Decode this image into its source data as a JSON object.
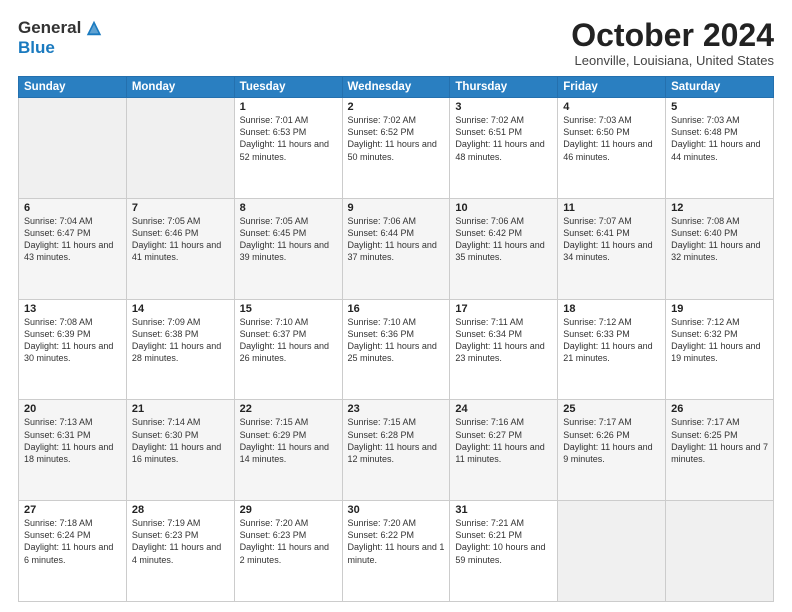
{
  "header": {
    "logo_general": "General",
    "logo_blue": "Blue",
    "month_title": "October 2024",
    "location": "Leonville, Louisiana, United States"
  },
  "weekdays": [
    "Sunday",
    "Monday",
    "Tuesday",
    "Wednesday",
    "Thursday",
    "Friday",
    "Saturday"
  ],
  "weeks": [
    [
      {
        "day": "",
        "info": ""
      },
      {
        "day": "",
        "info": ""
      },
      {
        "day": "1",
        "info": "Sunrise: 7:01 AM\nSunset: 6:53 PM\nDaylight: 11 hours and 52 minutes."
      },
      {
        "day": "2",
        "info": "Sunrise: 7:02 AM\nSunset: 6:52 PM\nDaylight: 11 hours and 50 minutes."
      },
      {
        "day": "3",
        "info": "Sunrise: 7:02 AM\nSunset: 6:51 PM\nDaylight: 11 hours and 48 minutes."
      },
      {
        "day": "4",
        "info": "Sunrise: 7:03 AM\nSunset: 6:50 PM\nDaylight: 11 hours and 46 minutes."
      },
      {
        "day": "5",
        "info": "Sunrise: 7:03 AM\nSunset: 6:48 PM\nDaylight: 11 hours and 44 minutes."
      }
    ],
    [
      {
        "day": "6",
        "info": "Sunrise: 7:04 AM\nSunset: 6:47 PM\nDaylight: 11 hours and 43 minutes."
      },
      {
        "day": "7",
        "info": "Sunrise: 7:05 AM\nSunset: 6:46 PM\nDaylight: 11 hours and 41 minutes."
      },
      {
        "day": "8",
        "info": "Sunrise: 7:05 AM\nSunset: 6:45 PM\nDaylight: 11 hours and 39 minutes."
      },
      {
        "day": "9",
        "info": "Sunrise: 7:06 AM\nSunset: 6:44 PM\nDaylight: 11 hours and 37 minutes."
      },
      {
        "day": "10",
        "info": "Sunrise: 7:06 AM\nSunset: 6:42 PM\nDaylight: 11 hours and 35 minutes."
      },
      {
        "day": "11",
        "info": "Sunrise: 7:07 AM\nSunset: 6:41 PM\nDaylight: 11 hours and 34 minutes."
      },
      {
        "day": "12",
        "info": "Sunrise: 7:08 AM\nSunset: 6:40 PM\nDaylight: 11 hours and 32 minutes."
      }
    ],
    [
      {
        "day": "13",
        "info": "Sunrise: 7:08 AM\nSunset: 6:39 PM\nDaylight: 11 hours and 30 minutes."
      },
      {
        "day": "14",
        "info": "Sunrise: 7:09 AM\nSunset: 6:38 PM\nDaylight: 11 hours and 28 minutes."
      },
      {
        "day": "15",
        "info": "Sunrise: 7:10 AM\nSunset: 6:37 PM\nDaylight: 11 hours and 26 minutes."
      },
      {
        "day": "16",
        "info": "Sunrise: 7:10 AM\nSunset: 6:36 PM\nDaylight: 11 hours and 25 minutes."
      },
      {
        "day": "17",
        "info": "Sunrise: 7:11 AM\nSunset: 6:34 PM\nDaylight: 11 hours and 23 minutes."
      },
      {
        "day": "18",
        "info": "Sunrise: 7:12 AM\nSunset: 6:33 PM\nDaylight: 11 hours and 21 minutes."
      },
      {
        "day": "19",
        "info": "Sunrise: 7:12 AM\nSunset: 6:32 PM\nDaylight: 11 hours and 19 minutes."
      }
    ],
    [
      {
        "day": "20",
        "info": "Sunrise: 7:13 AM\nSunset: 6:31 PM\nDaylight: 11 hours and 18 minutes."
      },
      {
        "day": "21",
        "info": "Sunrise: 7:14 AM\nSunset: 6:30 PM\nDaylight: 11 hours and 16 minutes."
      },
      {
        "day": "22",
        "info": "Sunrise: 7:15 AM\nSunset: 6:29 PM\nDaylight: 11 hours and 14 minutes."
      },
      {
        "day": "23",
        "info": "Sunrise: 7:15 AM\nSunset: 6:28 PM\nDaylight: 11 hours and 12 minutes."
      },
      {
        "day": "24",
        "info": "Sunrise: 7:16 AM\nSunset: 6:27 PM\nDaylight: 11 hours and 11 minutes."
      },
      {
        "day": "25",
        "info": "Sunrise: 7:17 AM\nSunset: 6:26 PM\nDaylight: 11 hours and 9 minutes."
      },
      {
        "day": "26",
        "info": "Sunrise: 7:17 AM\nSunset: 6:25 PM\nDaylight: 11 hours and 7 minutes."
      }
    ],
    [
      {
        "day": "27",
        "info": "Sunrise: 7:18 AM\nSunset: 6:24 PM\nDaylight: 11 hours and 6 minutes."
      },
      {
        "day": "28",
        "info": "Sunrise: 7:19 AM\nSunset: 6:23 PM\nDaylight: 11 hours and 4 minutes."
      },
      {
        "day": "29",
        "info": "Sunrise: 7:20 AM\nSunset: 6:23 PM\nDaylight: 11 hours and 2 minutes."
      },
      {
        "day": "30",
        "info": "Sunrise: 7:20 AM\nSunset: 6:22 PM\nDaylight: 11 hours and 1 minute."
      },
      {
        "day": "31",
        "info": "Sunrise: 7:21 AM\nSunset: 6:21 PM\nDaylight: 10 hours and 59 minutes."
      },
      {
        "day": "",
        "info": ""
      },
      {
        "day": "",
        "info": ""
      }
    ]
  ]
}
